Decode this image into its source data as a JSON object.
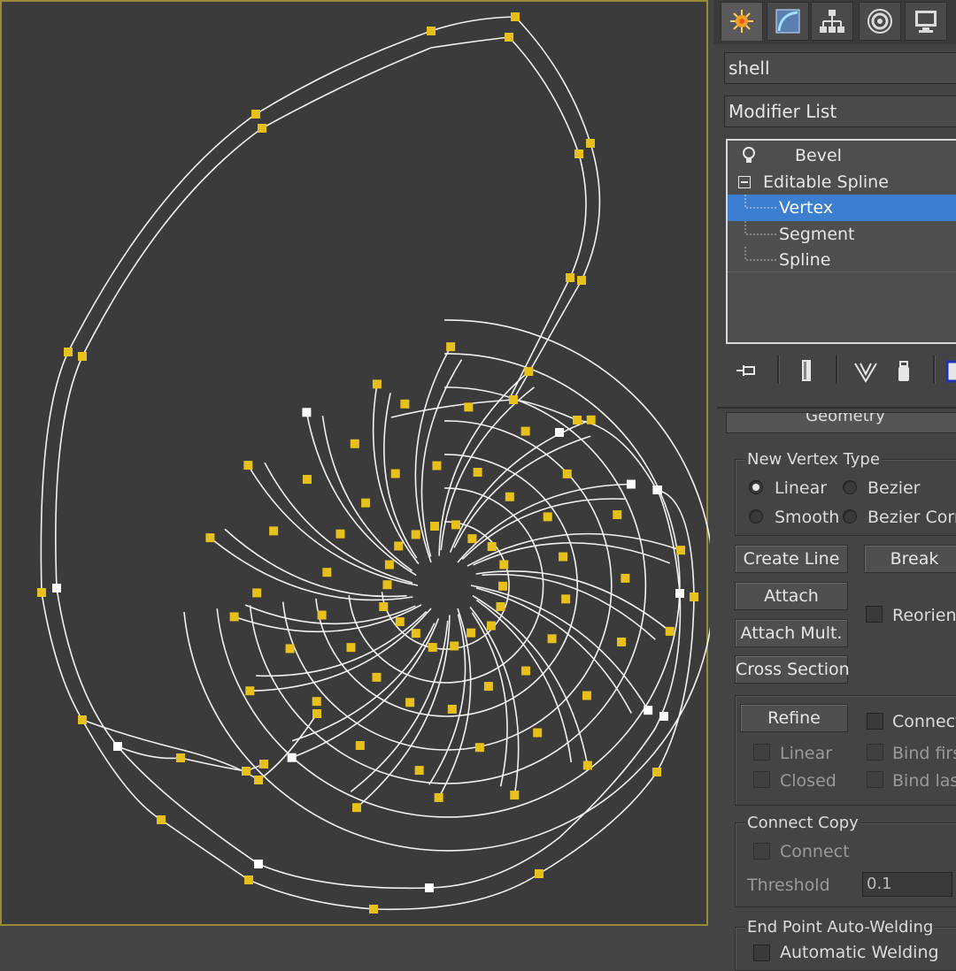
{
  "viewport": {
    "colors": {
      "background": "#3b3b3b",
      "spline": "#f2f2f2",
      "vertex": "#e8c01a",
      "vertex_first": "#ffffff"
    },
    "object_name": "shell"
  },
  "command_panel": {
    "tabs": [
      {
        "icon": "create-icon",
        "active": true
      },
      {
        "icon": "modify-icon",
        "active": false
      },
      {
        "icon": "hierarchy-icon",
        "active": false
      },
      {
        "icon": "motion-icon",
        "active": false
      },
      {
        "icon": "display-icon",
        "active": false
      }
    ],
    "object_name_value": "shell",
    "modifier_list_label": "Modifier List",
    "stack": {
      "items": [
        {
          "label": "Bevel",
          "icon": "lightbulb-icon"
        },
        {
          "label": "Editable Spline",
          "icon": "minus-box-icon"
        },
        {
          "label": "Vertex",
          "selected": true
        },
        {
          "label": "Segment"
        },
        {
          "label": "Spline"
        }
      ]
    },
    "stack_toolbar": [
      "pin-stack-icon",
      "show-end-result-icon",
      "make-unique-icon",
      "remove-modifier-icon",
      "configure-sets-icon"
    ],
    "rollout_title": "Geometry",
    "new_vertex_type": {
      "title": "New Vertex Type",
      "options": [
        {
          "label": "Linear",
          "selected": true
        },
        {
          "label": "Bezier",
          "selected": false
        },
        {
          "label": "Smooth",
          "selected": false
        },
        {
          "label": "Bezier Corn",
          "selected": false
        }
      ]
    },
    "buttons": {
      "create_line": "Create Line",
      "break": "Break",
      "attach": "Attach",
      "reorient": "Reorient",
      "attach_mult": "Attach Mult.",
      "cross_section": "Cross Section",
      "refine": "Refine",
      "connect": "Connect",
      "linear": "Linear",
      "bind_first": "Bind firs",
      "closed": "Closed",
      "bind_last": "Bind last"
    },
    "connect_copy": {
      "title": "Connect Copy",
      "connect_label": "Connect",
      "threshold_label": "Threshold",
      "threshold_value": "0.1"
    },
    "end_point_welding": {
      "title": "End Point Auto-Welding",
      "automatic_label": "Automatic Welding"
    }
  }
}
